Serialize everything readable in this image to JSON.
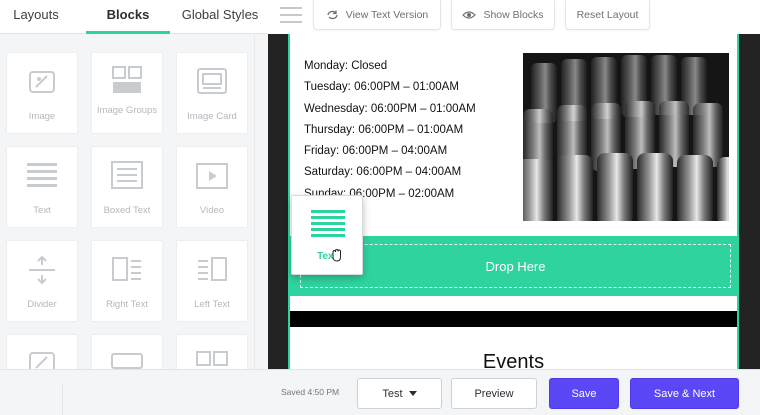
{
  "tabs": {
    "layouts": "Layouts",
    "blocks": "Blocks",
    "global_styles": "Global Styles"
  },
  "toolbar": {
    "view_text_version": "View Text Version",
    "show_blocks": "Show Blocks",
    "reset_layout": "Reset Layout"
  },
  "blocks": [
    {
      "label": "Image",
      "icon": "image-icon"
    },
    {
      "label": "Image Groups",
      "icon": "image-groups-icon"
    },
    {
      "label": "Image Card",
      "icon": "image-card-icon"
    },
    {
      "label": "Text",
      "icon": "text-icon"
    },
    {
      "label": "Boxed Text",
      "icon": "boxed-text-icon"
    },
    {
      "label": "Video",
      "icon": "video-icon"
    },
    {
      "label": "Divider",
      "icon": "divider-icon"
    },
    {
      "label": "Right Text",
      "icon": "right-text-icon"
    },
    {
      "label": "Left Text",
      "icon": "left-text-icon"
    },
    {
      "label": "",
      "icon": "image-icon"
    },
    {
      "label": "",
      "icon": "button-icon"
    },
    {
      "label": "",
      "icon": "social-icon"
    }
  ],
  "email": {
    "hours": [
      "Monday: Closed",
      "Tuesday: 06:00PM – 01:00AM",
      "Wednesday: 06:00PM – 01:00AM",
      "Thursday: 06:00PM – 01:00AM",
      "Friday: 06:00PM – 04:00AM",
      "Saturday: 06:00PM – 04:00AM",
      "Sunday: 06:00PM – 02:00AM"
    ],
    "drop_here": "Drop Here",
    "events_title": "Events"
  },
  "drag_card": {
    "label": "Text",
    "icon": "text-icon"
  },
  "footer": {
    "saved": "Saved 4:50 PM",
    "test": "Test",
    "preview": "Preview",
    "save": "Save",
    "save_next": "Save & Next"
  },
  "colors": {
    "accent": "#2fd3a0",
    "primary_button": "#5b47f5",
    "canvas_bg": "#232323"
  }
}
